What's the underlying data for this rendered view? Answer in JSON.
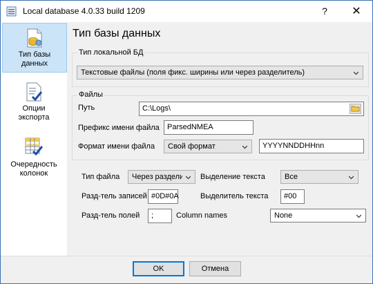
{
  "window": {
    "title": "Local database 4.0.33 build 1209",
    "help_label": "?",
    "close_label": "✕"
  },
  "sidebar": {
    "items": [
      {
        "label_line1": "Тип базы",
        "label_line2": "данных",
        "icon": "database-icon",
        "active": true
      },
      {
        "label_line1": "Опции",
        "label_line2": "экспорта",
        "icon": "export-options-icon",
        "active": false
      },
      {
        "label_line1": "Очередность",
        "label_line2": "колонок",
        "icon": "column-order-icon",
        "active": false
      }
    ]
  },
  "main": {
    "title": "Тип базы данных",
    "db_type_group": {
      "label": "Тип локальной БД",
      "selected": "Текстовые файлы (поля фикс. ширины или через разделитель)"
    },
    "files_group": {
      "label": "Файлы",
      "path_label": "Путь",
      "path_value": "C:\\Logs\\",
      "prefix_label": "Префикс имени файла",
      "prefix_value": "ParsedNMEA",
      "format_label": "Формат имени файла",
      "format_selected": "Свой формат",
      "format_value": "YYYYNNDDHHnn"
    },
    "options": {
      "file_type_label": "Тип файла",
      "file_type_selected": "Через раздели",
      "text_selection_label": "Выделение текста",
      "text_selection_selected": "Все",
      "record_sep_label": "Разд-тель записей",
      "record_sep_value": "#0D#0A",
      "text_delim_label": "Выделитель текста",
      "text_delim_value": "#00",
      "field_sep_label": "Разд-тель полей",
      "field_sep_value": ";",
      "column_names_label": "Column names",
      "column_names_selected": "None"
    }
  },
  "footer": {
    "ok_label": "OK",
    "cancel_label": "Отмена"
  },
  "colors": {
    "accent": "#0078d7",
    "active_item_bg": "#cce4f7"
  }
}
